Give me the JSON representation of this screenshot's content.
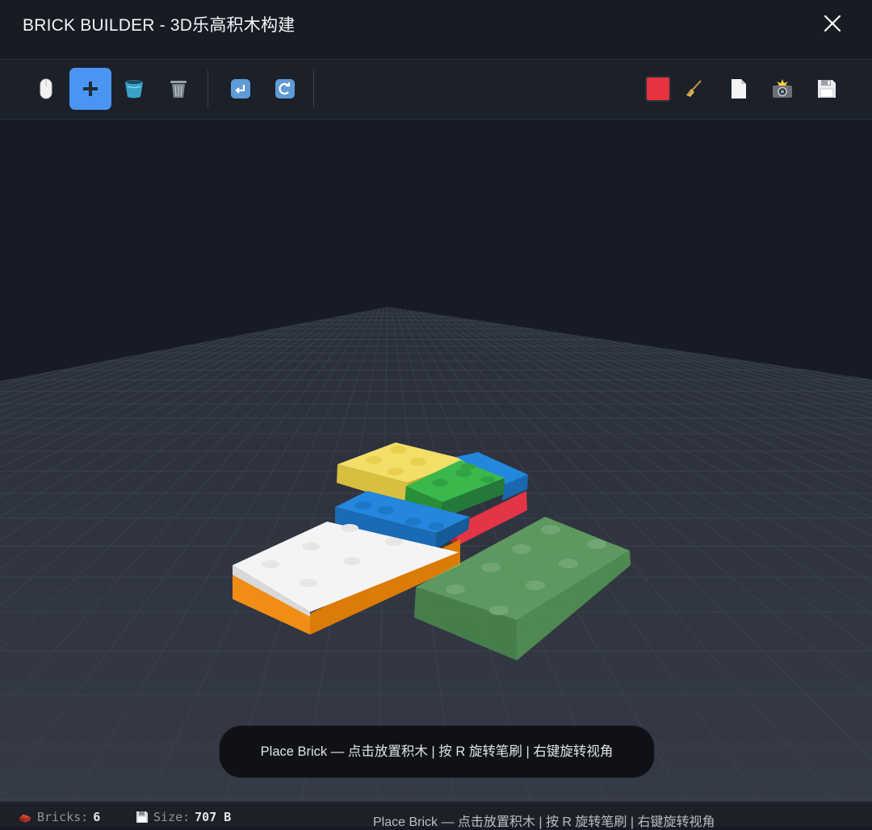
{
  "window": {
    "title": "BRICK BUILDER - 3D乐高积木构建",
    "close_icon": "close-icon"
  },
  "toolbar": {
    "tools": [
      {
        "name": "select-tool",
        "icon": "mouse-icon",
        "active": false
      },
      {
        "name": "place-brick-tool",
        "icon": "plus-icon",
        "active": true
      },
      {
        "name": "paint-bucket-tool",
        "icon": "bucket-icon",
        "active": false
      },
      {
        "name": "delete-tool",
        "icon": "trash-icon",
        "active": false
      }
    ],
    "history": [
      {
        "name": "undo-button",
        "icon": "undo-icon"
      },
      {
        "name": "redo-button",
        "icon": "redo-icon"
      }
    ],
    "right": [
      {
        "name": "color-swatch",
        "icon": "color-swatch",
        "color": "#e8323f"
      },
      {
        "name": "clear-button",
        "icon": "broom-icon"
      },
      {
        "name": "new-file-button",
        "icon": "document-icon"
      },
      {
        "name": "screenshot-button",
        "icon": "camera-flash-icon"
      },
      {
        "name": "save-button",
        "icon": "floppy-disk-icon"
      }
    ]
  },
  "scene": {
    "brick_colors": {
      "yellow": "#f2dc63",
      "green": "#38b34a",
      "blue": "#1f7fd6",
      "red": "#e33442",
      "white": "#f2f2f2",
      "orange": "#f08c12",
      "ghost": "#7cc67a"
    }
  },
  "hint": {
    "text": "Place Brick — 点击放置积木 | 按 R 旋转笔刷 | 右键旋转视角"
  },
  "status": {
    "bricks_label": "Bricks:",
    "bricks_value": "6",
    "size_label": "Size:",
    "size_value": "707 B",
    "message": "Place Brick — 点击放置积木 | 按 R 旋转笔刷 | 右键旋转视角"
  }
}
